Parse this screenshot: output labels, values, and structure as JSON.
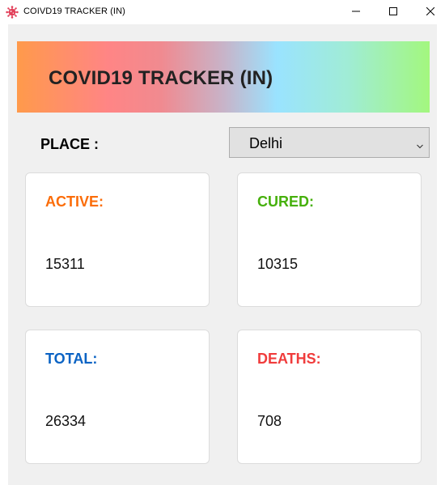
{
  "window": {
    "title": "COIVD19 TRACKER (IN)",
    "app_icon": "virus-icon",
    "controls": {
      "minimize": "minimize-icon",
      "maximize": "maximize-icon",
      "close": "close-icon"
    }
  },
  "banner": {
    "title": "COVID19 TRACKER (IN)"
  },
  "place": {
    "label": "PLACE :",
    "selected": "Delhi"
  },
  "stats": {
    "active": {
      "label": "ACTIVE:",
      "value": "15311",
      "color": "#fb6d0a"
    },
    "cured": {
      "label": "CURED:",
      "value": "10315",
      "color": "#46b00c"
    },
    "total": {
      "label": "TOTAL:",
      "value": "26334",
      "color": "#0b63c4"
    },
    "deaths": {
      "label": "DEATHS:",
      "value": "708",
      "color": "#f03c3c"
    }
  },
  "colors": {
    "banner_gradient": [
      "#ff9a4b",
      "#ff8585",
      "#9ae3ff",
      "#a3f77e"
    ],
    "client_background": "#f0f0f0",
    "card_background": "#ffffff"
  }
}
